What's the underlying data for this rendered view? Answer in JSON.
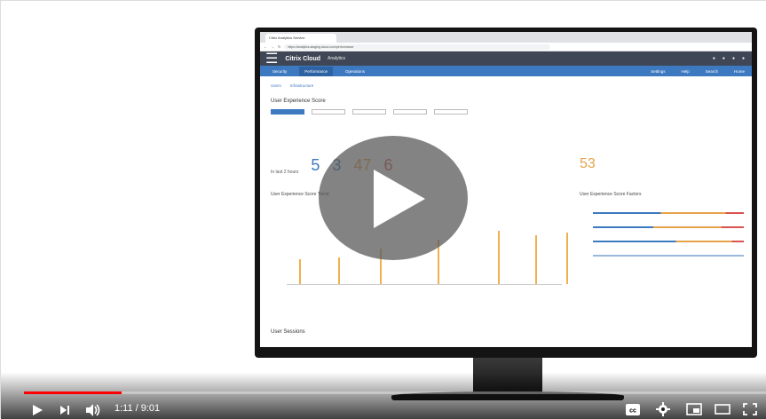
{
  "player": {
    "time_display": "1:11 / 9:01",
    "progress_fraction": 0.131,
    "controls": {
      "play": "play-icon",
      "next": "next-icon",
      "volume": "volume-icon",
      "captions": "cc",
      "settings": "gear-icon",
      "miniplayer": "miniplayer-icon",
      "theater": "theater-icon",
      "fullscreen": "fullscreen-icon"
    },
    "colors": {
      "progress": "#ff0000",
      "play_overlay": "#5a5a5a"
    }
  },
  "screen": {
    "tab_title": "Citrix Analytics Service",
    "url": "https://analytics-staging.cloud.com/performance",
    "brand": "Citrix Cloud",
    "brand_sub": "Analytics",
    "nav": {
      "items": [
        "Security",
        "Performance",
        "Operations"
      ],
      "right": [
        "Settings",
        "Help",
        "Search",
        "Home"
      ]
    },
    "subtabs": [
      "Users",
      "Infrastructure"
    ],
    "section_title": "User Experience Score",
    "stats_label": "In last 2 hours",
    "stats": [
      "5",
      "3",
      "47",
      "6"
    ],
    "ux_score": "53",
    "chart_left_title": "User Experience Score Trend",
    "chart_right_title": "User Experience Score Factors",
    "sessions_title": "User Sessions"
  }
}
